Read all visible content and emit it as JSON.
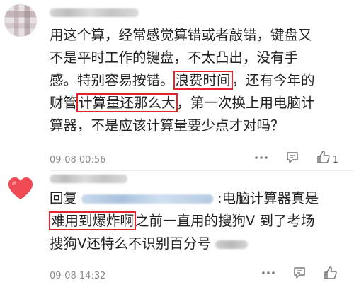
{
  "comments": [
    {
      "lines": [
        [
          {
            "t": "用这个算，经常感觉算错或者敲错，键盘又"
          }
        ],
        [
          {
            "t": "不是平时工作的键盘，不太凸出，没有手"
          }
        ],
        [
          {
            "t": "感。特别容易按错。"
          },
          {
            "t": "浪费时间",
            "mark": true
          },
          {
            "t": "，还有今年的"
          }
        ],
        [
          {
            "t": "财管"
          },
          {
            "t": "计算量还那么大",
            "mark": true
          },
          {
            "t": "，第一次换上用电脑计"
          }
        ],
        [
          {
            "t": "算器，不是应该计算量要少点才对吗？"
          }
        ]
      ],
      "time": "09-08 00:56",
      "likes": "1"
    },
    {
      "reply_prefix": "回复",
      "reply_suffix": ":电脑计算器真是",
      "line2_mark": "难用到爆炸啊",
      "line2_rest": "之前一直用的搜狗V 到了考场",
      "line3": "搜狗V还特么不识别百分号",
      "time": "09-08 14:32",
      "likes": ""
    }
  ],
  "icons": {
    "more": "more-icon",
    "reply": "comment-icon",
    "like": "thumbs-up-icon",
    "avatar2": "heart-icon"
  },
  "colors": {
    "highlight_border": "#e4252c",
    "heart": "#f04a55",
    "time_text": "#8a8a8a"
  }
}
